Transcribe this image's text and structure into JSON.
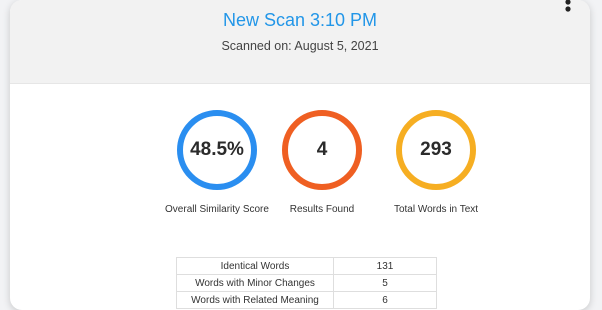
{
  "header": {
    "title": "New Scan 3:10 PM",
    "subtitle": "Scanned on: August 5, 2021"
  },
  "metrics": [
    {
      "value": "48.5%",
      "label": "Overall Similarity Score",
      "color": "#2a8ef0"
    },
    {
      "value": "4",
      "label": "Results Found",
      "color": "#ef5f22"
    },
    {
      "value": "293",
      "label": "Total Words in Text",
      "color": "#f6ae22"
    }
  ],
  "stats_table": {
    "rows": [
      {
        "label": "Identical Words",
        "value": "131"
      },
      {
        "label": "Words with Minor Changes",
        "value": "5"
      },
      {
        "label": "Words with Related Meaning",
        "value": "6"
      }
    ]
  },
  "icons": {
    "menu": "more-vertical-icon"
  }
}
